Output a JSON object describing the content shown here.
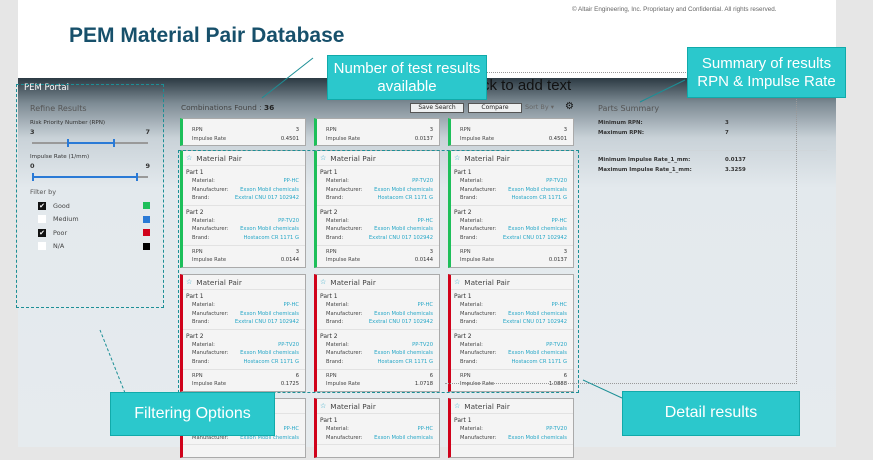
{
  "slide": {
    "copyright": "© Altair Engineering, Inc. Proprietary and Confidential. All rights reserved.",
    "title": "PEM Material Pair Database",
    "placeholder_text": "ck to add text"
  },
  "app": {
    "name": "PEM Portal"
  },
  "sidebar": {
    "heading": "Refine Results",
    "rpn": {
      "label": "Risk Priority Number (RPN)",
      "min": "3",
      "max": "7",
      "range_min": 1,
      "range_max": 10,
      "value": [
        3,
        7
      ]
    },
    "impulse": {
      "label": "Impulse Rate (1/mm)",
      "min": "0",
      "max": "9",
      "range_min": 0,
      "range_max": 10,
      "value": [
        0,
        9
      ]
    },
    "filter_heading": "Filter by",
    "filters": [
      {
        "label": "Good",
        "checked": true,
        "color": "#1dbf5a"
      },
      {
        "label": "Medium",
        "checked": false,
        "color": "#2a7ad6"
      },
      {
        "label": "Poor",
        "checked": true,
        "color": "#d0021b"
      },
      {
        "label": "N/A",
        "checked": false,
        "color": "#000000"
      }
    ]
  },
  "toolbar": {
    "combinations_label": "Combinations Found :",
    "combinations_count": "36",
    "save_search": "Save Search",
    "compare": "Compare",
    "sort_by": "Sort By"
  },
  "labels": {
    "card_title": "Material Pair",
    "part1": "Part 1",
    "part2": "Part 2",
    "material": "Material:",
    "manufacturer": "Manufacturer:",
    "brand": "Brand:",
    "rpn": "RPN",
    "impulse": "Impulse Rate"
  },
  "partial_cards": [
    {
      "rpn": "3",
      "impulse": "0.4501"
    },
    {
      "rpn": "3",
      "impulse": "0.0137"
    },
    {
      "rpn": "3",
      "impulse": "0.4501"
    }
  ],
  "cards": [
    {
      "status": "good",
      "p1": [
        "PP-HC",
        "Exxon Mobil chemicals",
        "Exxtral CNU 017 102942"
      ],
      "p2": [
        "PP-TV20",
        "Exxon Mobil chemicals",
        "Hostacom CR 1171 G"
      ],
      "rpn": "3",
      "impulse": "0.0144"
    },
    {
      "status": "good",
      "p1": [
        "PP-TV20",
        "Exxon Mobil chemicals",
        "Hostacom CR 1171 G"
      ],
      "p2": [
        "PP-HC",
        "Exxon Mobil chemicals",
        "Exxtral CNU 017 102942"
      ],
      "rpn": "3",
      "impulse": "0.0144"
    },
    {
      "status": "good",
      "p1": [
        "PP-TV20",
        "Exxon Mobil chemicals",
        "Hostacom CR 1171 G"
      ],
      "p2": [
        "PP-HC",
        "Exxon Mobil chemicals",
        "Exxtral CNU 017 102942"
      ],
      "rpn": "3",
      "impulse": "0.0137"
    },
    {
      "status": "poor",
      "p1": [
        "PP-HC",
        "Exxon Mobil chemicals",
        "Exxtral CNU 017 102942"
      ],
      "p2": [
        "PP-TV20",
        "Exxon Mobil chemicals",
        "Hostacom CR 1171 G"
      ],
      "rpn": "6",
      "impulse": "0.1725"
    },
    {
      "status": "poor",
      "p1": [
        "PP-HC",
        "Exxon Mobil chemicals",
        "Exxtral CNU 017 102942"
      ],
      "p2": [
        "PP-TV20",
        "Exxon Mobil chemicals",
        "Hostacom CR 1171 G"
      ],
      "rpn": "6",
      "impulse": "1.0718"
    },
    {
      "status": "poor",
      "p1": [
        "PP-HC",
        "Exxon Mobil chemicals",
        "Exxtral CNU 017 102942"
      ],
      "p2": [
        "PP-TV20",
        "Exxon Mobil chemicals",
        "Hostacom CR 1171 G"
      ],
      "rpn": "6",
      "impulse": "1.0888"
    },
    {
      "status": "poor",
      "p1": [
        "PP-HC",
        "Exxon Mobil chemicals"
      ]
    },
    {
      "status": "poor",
      "p1": [
        "PP-HC",
        "Exxon Mobil chemicals"
      ]
    },
    {
      "status": "poor",
      "p1": [
        "PP-TV20",
        "Exxon Mobil chemicals"
      ]
    }
  ],
  "summary": {
    "heading": "Parts Summary",
    "min_rpn_label": "Minimum RPN:",
    "min_rpn": "3",
    "max_rpn_label": "Maximum RPN:",
    "max_rpn": "7",
    "min_ir_label": "Minimum Impulse Rate_1_mm:",
    "min_ir": "0.0137",
    "max_ir_label": "Maximum Impulse Rate_1_mm:",
    "max_ir": "3.3259"
  },
  "callouts": {
    "count": "Number of test results available",
    "summary": "Summary of results RPN & Impulse Rate",
    "filter": "Filtering Options",
    "detail": "Detail results"
  }
}
